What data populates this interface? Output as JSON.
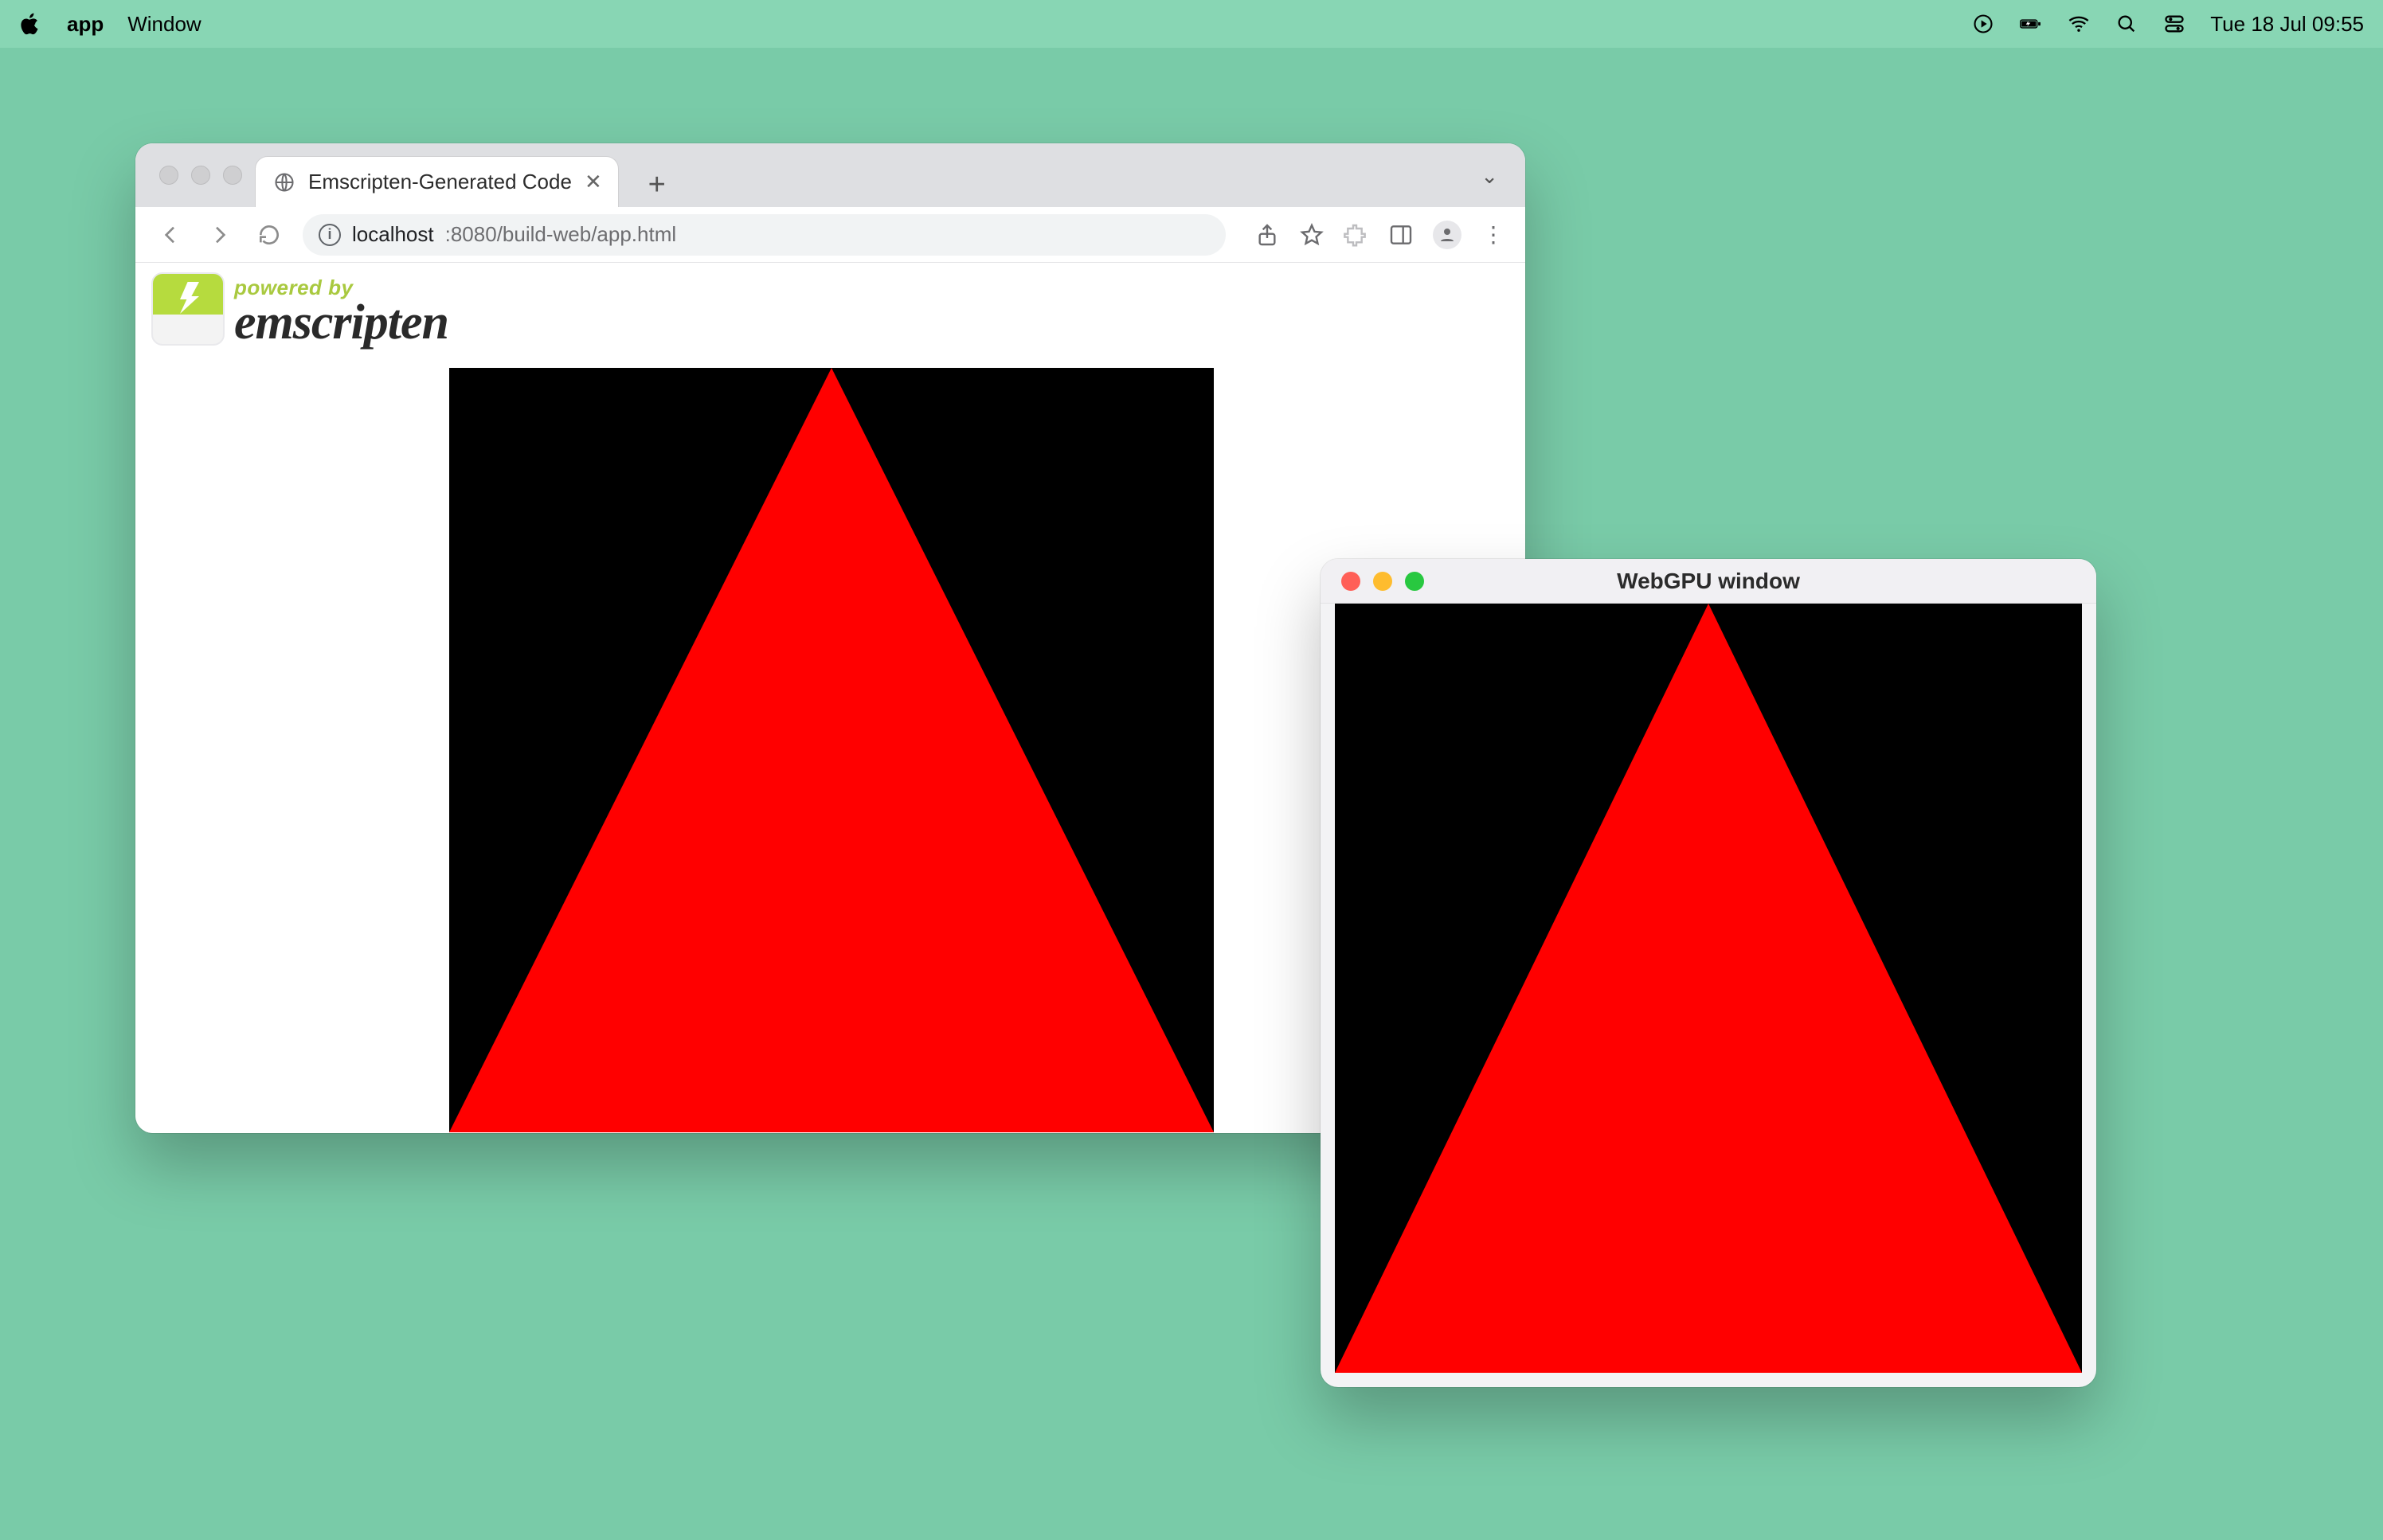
{
  "menubar": {
    "app": "app",
    "items": [
      "Window"
    ],
    "clock": "Tue 18 Jul  09:55"
  },
  "chrome": {
    "tab_title": "Emscripten-Generated Code",
    "url_host": "localhost",
    "url_path": ":8080/build-web/app.html"
  },
  "emscripten": {
    "powered_by": "powered by",
    "name": "emscripten"
  },
  "native": {
    "title": "WebGPU window"
  },
  "colors": {
    "desktop": "#79cba8",
    "triangle": "#ff0000",
    "canvas_bg": "#000000"
  }
}
